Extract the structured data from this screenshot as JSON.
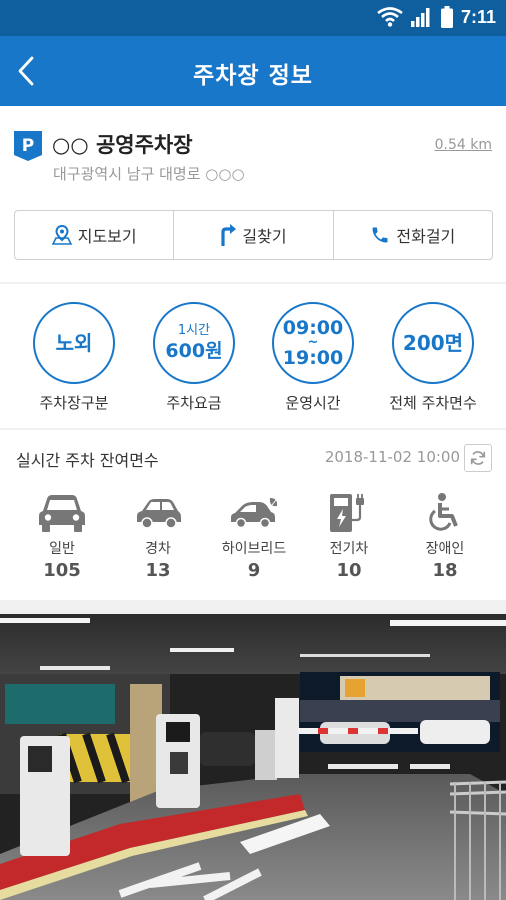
{
  "status_bar": {
    "time": "7:11"
  },
  "app_bar": {
    "title": "주차장 정보"
  },
  "lot": {
    "name": "○○ 공영주차장",
    "address": "대구광역시 남구 대명로 ○○○",
    "distance": "0.54 km"
  },
  "actions": [
    {
      "label": "지도보기",
      "icon": "map-icon"
    },
    {
      "label": "길찾기",
      "icon": "directions-icon"
    },
    {
      "label": "전화걸기",
      "icon": "phone-icon"
    }
  ],
  "info": [
    {
      "value": "노외",
      "label": "주차장구분"
    },
    {
      "value_top": "1시간",
      "value": "600원",
      "label": "주차요금"
    },
    {
      "value_top": "09:00",
      "value_mid": "~",
      "value": "19:00",
      "label": "운영시간"
    },
    {
      "value": "200면",
      "label": "전체 주차면수"
    }
  ],
  "realtime": {
    "title": "실시간 주차 잔여면수",
    "datetime": "2018-11-02 10:00",
    "slots": [
      {
        "label": "일반",
        "count": "105",
        "icon": "car-icon"
      },
      {
        "label": "경차",
        "count": "13",
        "icon": "compact-car-icon"
      },
      {
        "label": "하이브리드",
        "count": "9",
        "icon": "hybrid-car-icon"
      },
      {
        "label": "전기차",
        "count": "10",
        "icon": "ev-charger-icon"
      },
      {
        "label": "장애인",
        "count": "18",
        "icon": "wheelchair-icon"
      }
    ]
  },
  "colors": {
    "primary": "#1877c9",
    "status_bar": "#0f5f9f",
    "icon_gray": "#777777"
  }
}
